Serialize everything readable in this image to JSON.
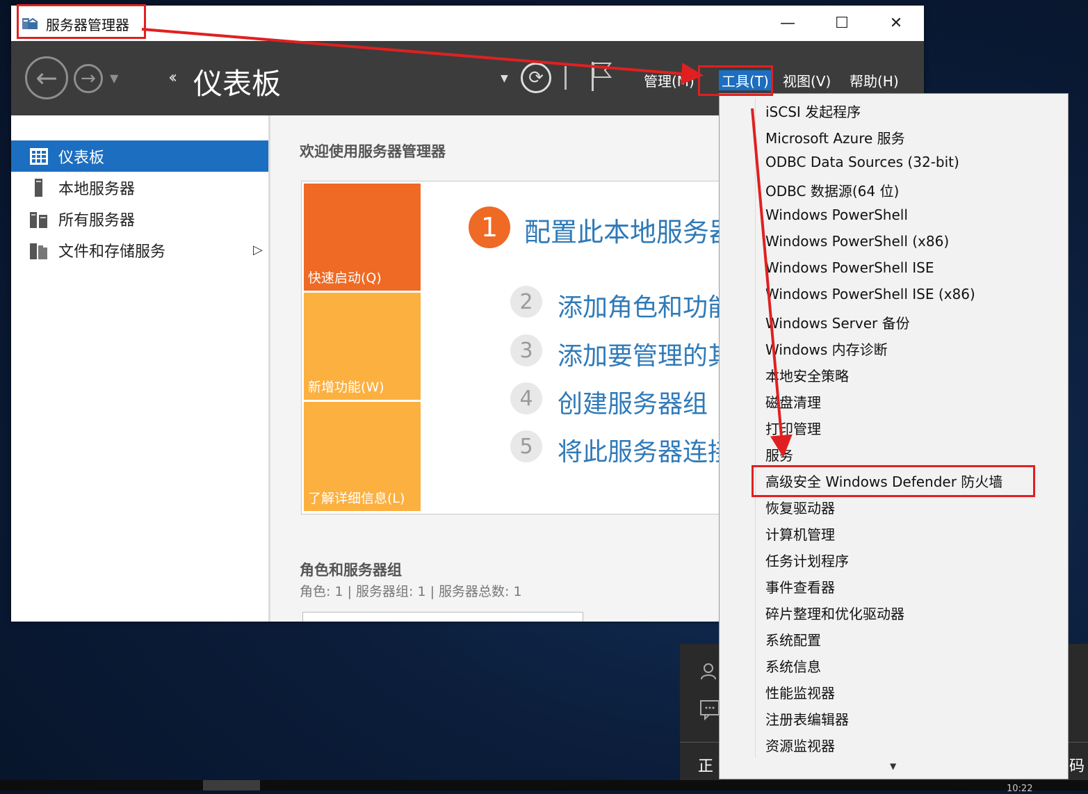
{
  "window": {
    "title": "服务器管理器",
    "minimize": "—",
    "maximize": "☐",
    "close": "✕"
  },
  "navbar": {
    "breadcrumb_title": "仪表板",
    "menus": [
      "管理(M)",
      "工具(T)",
      "视图(V)",
      "帮助(H)"
    ]
  },
  "sidebar": {
    "items": [
      {
        "label": "仪表板",
        "icon": "dashboard-icon",
        "active": true
      },
      {
        "label": "本地服务器",
        "icon": "server-icon",
        "active": false
      },
      {
        "label": "所有服务器",
        "icon": "servers-icon",
        "active": false
      },
      {
        "label": "文件和存储服务",
        "icon": "storage-icon",
        "active": false
      }
    ]
  },
  "main": {
    "welcome": "欢迎使用服务器管理器",
    "tiles": [
      "快速启动(Q)",
      "新增功能(W)",
      "了解详细信息(L)"
    ],
    "steps": [
      {
        "num": "1",
        "label": "配置此本地服务器"
      },
      {
        "num": "2",
        "label": "添加角色和功能"
      },
      {
        "num": "3",
        "label": "添加要管理的其他服务器"
      },
      {
        "num": "4",
        "label": "创建服务器组"
      },
      {
        "num": "5",
        "label": "将此服务器连接到云服务"
      }
    ],
    "roles_title": "角色和服务器组",
    "roles_sub": "角色: 1 | 服务器组: 1 | 服务器总数: 1"
  },
  "tools_menu": {
    "items": [
      "iSCSI 发起程序",
      "Microsoft Azure 服务",
      "ODBC Data Sources (32-bit)",
      "ODBC 数据源(64 位)",
      "Windows PowerShell",
      "Windows PowerShell (x86)",
      "Windows PowerShell ISE",
      "Windows PowerShell ISE (x86)",
      "Windows Server 备份",
      "Windows 内存诊断",
      "本地安全策略",
      "磁盘清理",
      "打印管理",
      "服务",
      "高级安全 Windows Defender 防火墙",
      "恢复驱动器",
      "计算机管理",
      "任务计划程序",
      "事件查看器",
      "碎片整理和优化驱动器",
      "系统配置",
      "系统信息",
      "性能监视器",
      "注册表编辑器",
      "资源监视器"
    ],
    "highlighted": "高级安全 Windows Defender 防火墙"
  },
  "background": {
    "notif_left": "正",
    "notif_right": "码",
    "clock": "10:22"
  },
  "colors": {
    "accent_blue": "#1c6ec0",
    "annotation_red": "#e02020",
    "tile_orange": "#ee6a25",
    "tile_yellow": "#fcb040"
  }
}
